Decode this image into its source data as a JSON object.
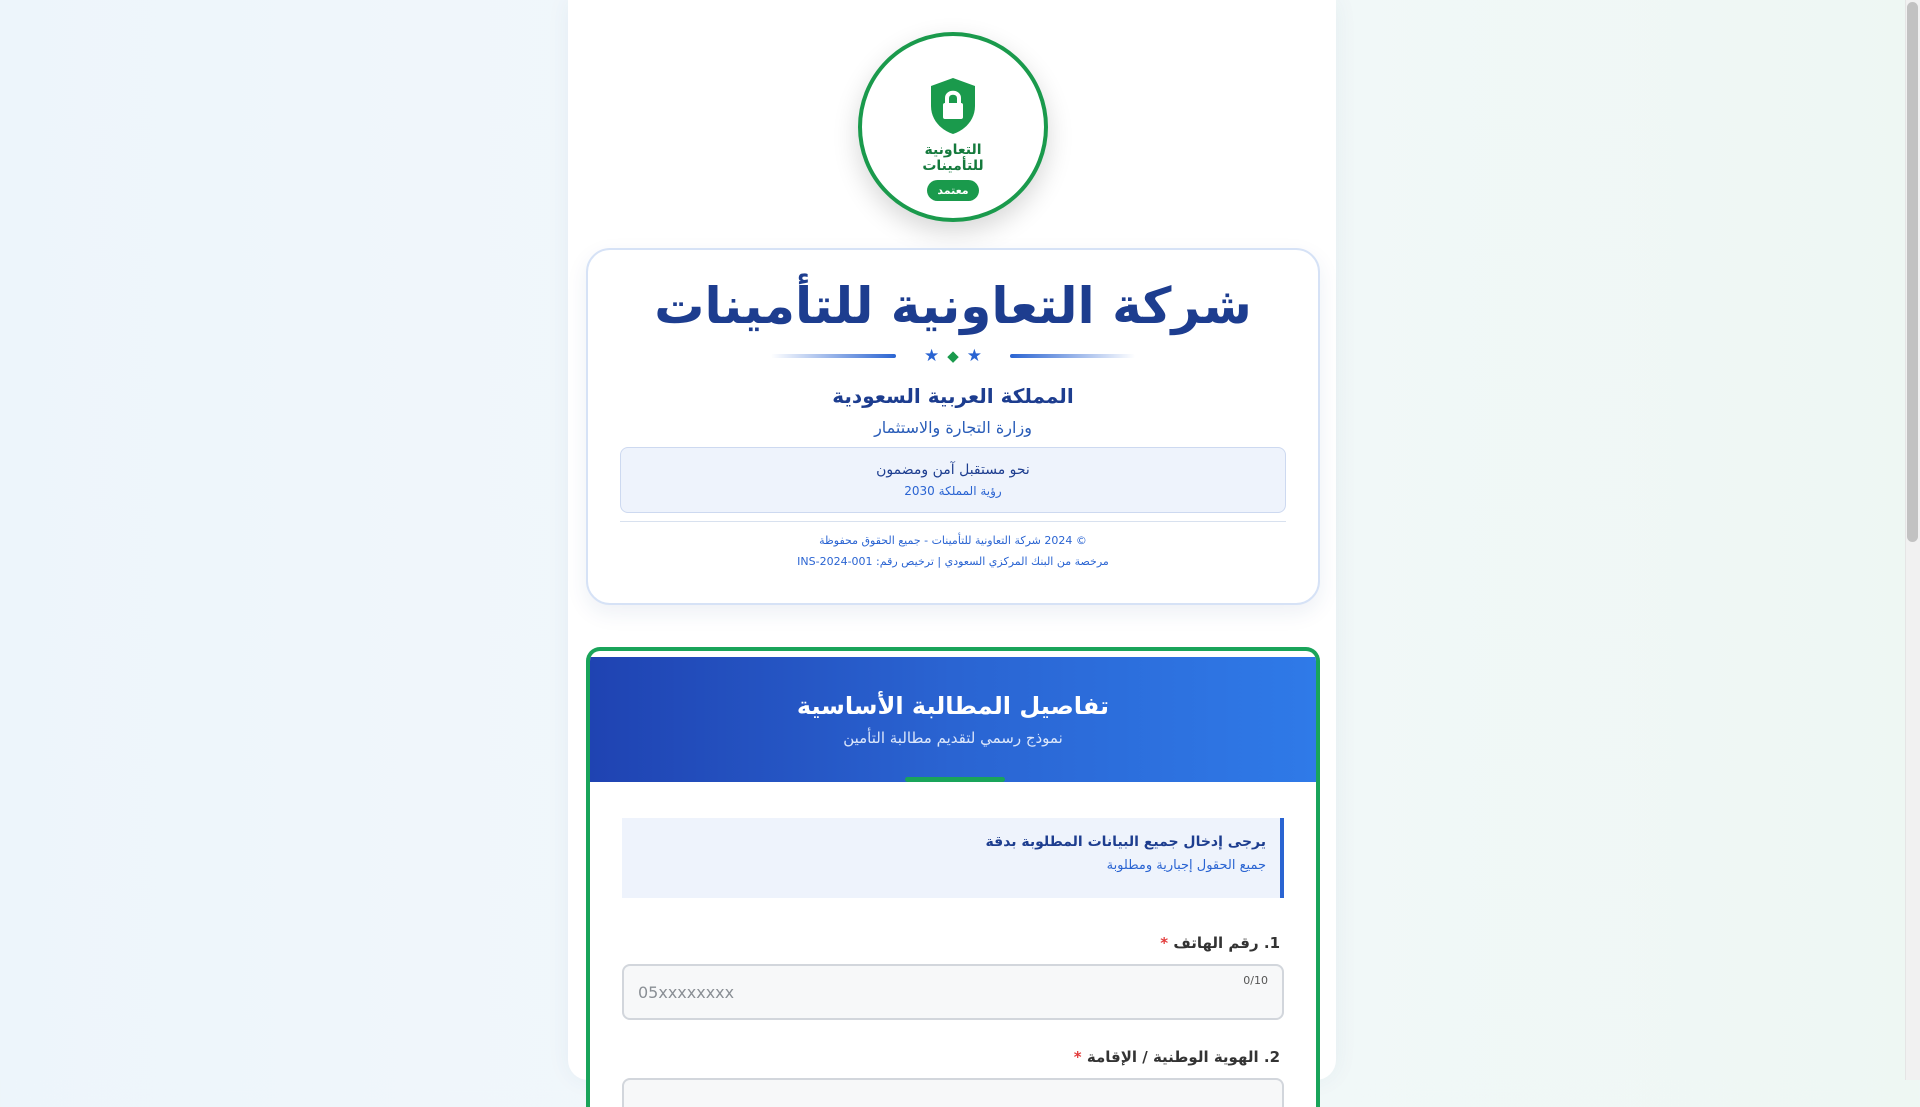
{
  "logo": {
    "text": "التعاونية للتأمينات",
    "badge": "معتمد",
    "icon": "shield-lock-icon"
  },
  "company": {
    "title": "شركة التعاونية للتأمينات",
    "kingdom": "المملكة العربية السعودية",
    "ministry": "وزارة التجارة والاستثمار",
    "vision_main": "نحو مستقبل آمن ومضمون",
    "vision_sub": "رؤية المملكة 2030",
    "copyright": "© 2024 شركة التعاونية للتأمينات - جميع الحقوق محفوظة",
    "license": "مرخصة من البنك المركزي السعودي | ترخيص رقم: INS-2024-001"
  },
  "form": {
    "title": "تفاصيل المطالبة الأساسية",
    "subtitle": "نموذج رسمي لتقديم مطالبة التأمين",
    "notice_title": "يرجى إدخال جميع البيانات المطلوبة بدقة",
    "notice_sub": "جميع الحقول إجبارية ومطلوبة",
    "fields": [
      {
        "label": "1. رقم الهاتف",
        "required": "*",
        "placeholder": "05xxxxxxxx",
        "counter": "0/10"
      },
      {
        "label": "2. الهوية الوطنية / الإقامة",
        "required": "*"
      }
    ]
  },
  "colors": {
    "primary_blue": "#1d3d8f",
    "accent_blue": "#2a64d2",
    "brand_green": "#1a9a4c",
    "required_red": "#e23b3b"
  }
}
